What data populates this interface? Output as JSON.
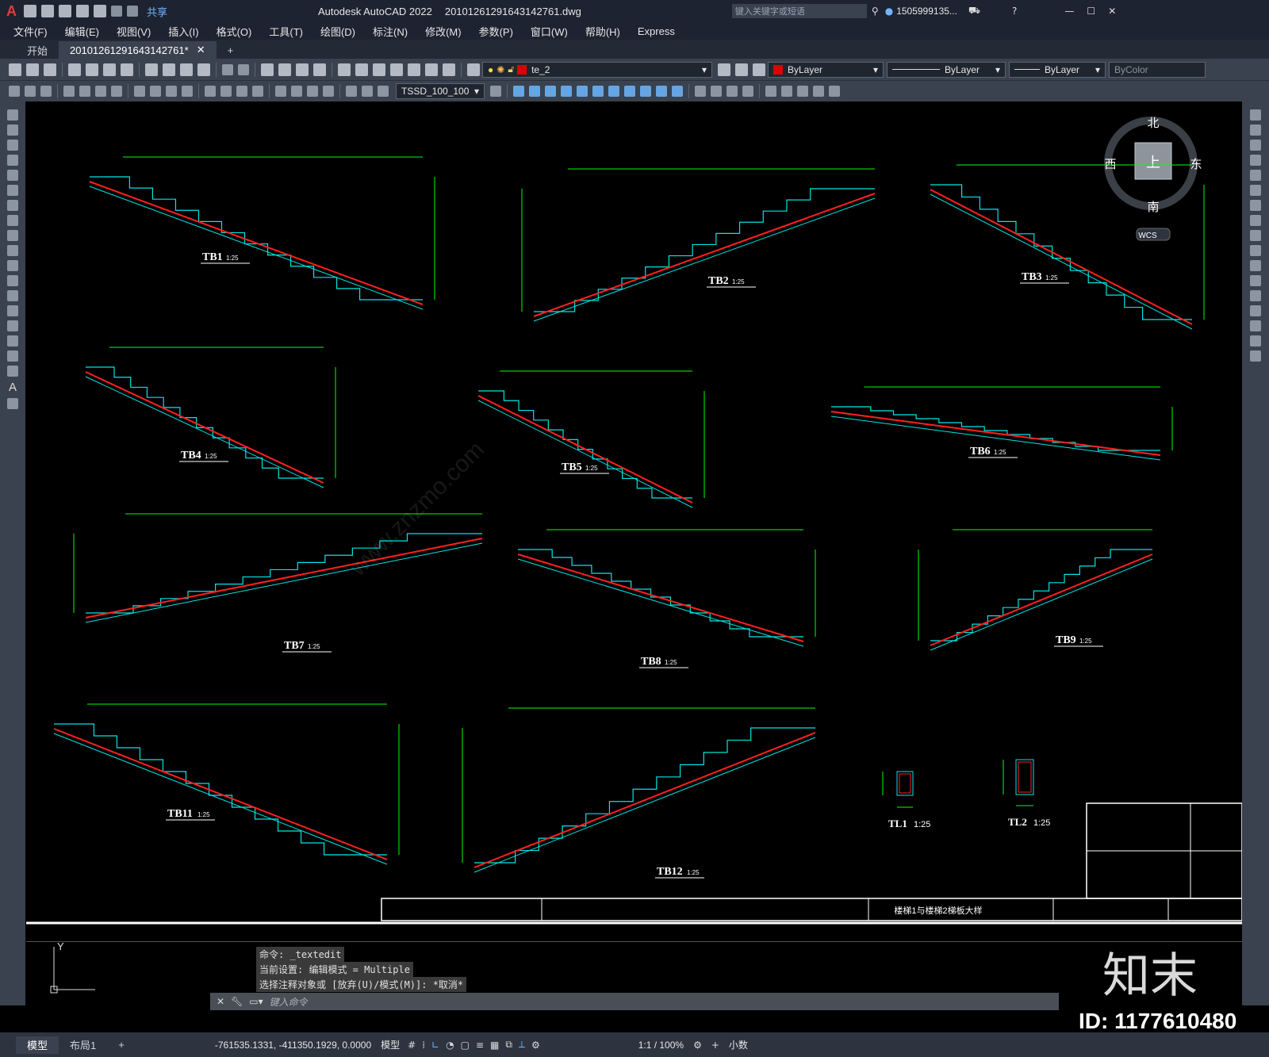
{
  "app": {
    "title": "Autodesk AutoCAD 2022",
    "filename": "20101261291643142761.dwg",
    "share_label": "共享",
    "search_placeholder": "键入关键字或短语",
    "user": "1505999135...",
    "logo_letter": "A"
  },
  "menu": [
    "文件(F)",
    "编辑(E)",
    "视图(V)",
    "插入(I)",
    "格式(O)",
    "工具(T)",
    "绘图(D)",
    "标注(N)",
    "修改(M)",
    "参数(P)",
    "窗口(W)",
    "帮助(H)",
    "Express"
  ],
  "tabs": {
    "start": "开始",
    "doc": "20101261291643142761*",
    "add": "+"
  },
  "toolbar": {
    "layer": "te_2",
    "color": "ByLayer",
    "linetype": "ByLayer",
    "lineweight": "ByLayer",
    "plotstyle": "ByColor",
    "dimstyle": "TSSD_100_100",
    "color_swatch": "#e00000"
  },
  "viewcube": {
    "north": "北",
    "south": "南",
    "east": "东",
    "west": "西",
    "top": "上",
    "wcs": "WCS"
  },
  "drawings": [
    {
      "title": "TB1",
      "scale": "1:25"
    },
    {
      "title": "TB2",
      "scale": "1:25"
    },
    {
      "title": "TB3",
      "scale": "1:25"
    },
    {
      "title": "TB4",
      "scale": "1:25"
    },
    {
      "title": "TB5",
      "scale": "1:25"
    },
    {
      "title": "TB6",
      "scale": "1:25"
    },
    {
      "title": "TB7",
      "scale": "1:25"
    },
    {
      "title": "TB8",
      "scale": "1:25"
    },
    {
      "title": "TB9",
      "scale": "1:25"
    },
    {
      "title": "TB11",
      "scale": "1:25"
    },
    {
      "title": "TB12",
      "scale": "1:25"
    },
    {
      "title": "TL1",
      "scale": "1:25"
    },
    {
      "title": "TL2",
      "scale": "1:25"
    }
  ],
  "titleblock": {
    "drawing_name": "楼梯1与楼梯2梯板大样"
  },
  "command": {
    "history": [
      "命令: _textedit",
      "当前设置: 编辑模式 = Multiple",
      "选择注释对象或 [放弃(U)/模式(M)]: *取消*"
    ],
    "placeholder": "键入命令"
  },
  "axis": {
    "y": "Y"
  },
  "layouts": {
    "model": "模型",
    "layout1": "布局1",
    "add": "+"
  },
  "status": {
    "coords": "-761535.1331, -411350.1929, 0.0000",
    "mode": "模型",
    "scale": "1:1 / 100%",
    "units": "小数"
  },
  "watermark": {
    "brand": "知末",
    "id": "ID: 1177610480",
    "url": "www.znzmo.com"
  }
}
